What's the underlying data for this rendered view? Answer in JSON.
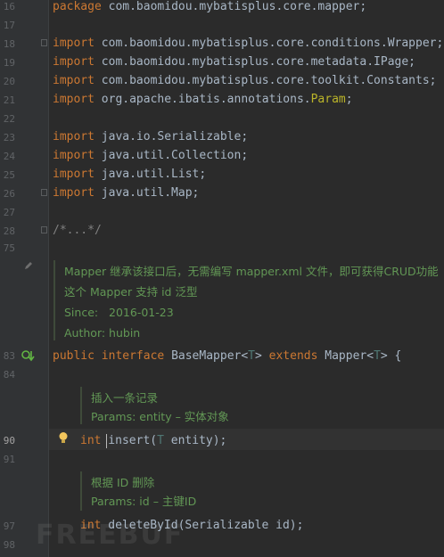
{
  "gutter": {
    "line_numbers": [
      "16",
      "17",
      "18",
      "19",
      "20",
      "21",
      "22",
      "23",
      "24",
      "25",
      "26",
      "27",
      "28",
      "75",
      "83",
      "84",
      "90",
      "91",
      "97",
      "98"
    ]
  },
  "code": {
    "l16": {
      "kw": "package",
      "rest": " com.baomidou.mybatisplus.core.mapper;"
    },
    "l18": {
      "kw": "import",
      "rest": " com.baomidou.mybatisplus.core.conditions.Wrapper;"
    },
    "l19": {
      "kw": "import",
      "rest": " com.baomidou.mybatisplus.core.metadata.IPage;"
    },
    "l20": {
      "kw": "import",
      "rest": " com.baomidou.mybatisplus.core.toolkit.Constants;"
    },
    "l21": {
      "kw": "import",
      "rest": " org.apache.ibatis.annotations.",
      "ann": "Param",
      "end": ";"
    },
    "l23": {
      "kw": "import",
      "rest": " java.io.Serializable;"
    },
    "l24": {
      "kw": "import",
      "rest": " java.util.Collection;"
    },
    "l25": {
      "kw": "import",
      "rest": " java.util.List;"
    },
    "l26": {
      "kw": "import",
      "rest": " java.util.Map;"
    },
    "l28": "/*...*/",
    "l83": {
      "kw1": "public",
      "kw2": "interface",
      "cls": "BaseMapper<",
      "tp": "T",
      "mid": "> ",
      "kw3": "extends",
      "cls2": " Mapper<",
      "tp2": "T",
      "end": "> {"
    },
    "l90": {
      "kw": "int",
      "name": " insert(",
      "tp": "T",
      "rest": " entity);"
    },
    "l97": {
      "kw": "int",
      "name": " deleteById(Serializable id);"
    }
  },
  "docs": {
    "class_doc": [
      "Mapper 继承该接口后，无需编写 mapper.xml 文件，即可获得CRUD功能",
      "这个 Mapper 支持 id 泛型",
      "Since:   2016-01-23",
      "Author: hubin"
    ],
    "insert_doc": [
      "插入一条记录",
      "Params: entity – 实体对象"
    ],
    "delete_doc": [
      "根据 ID 删除",
      "Params: id – 主键ID"
    ]
  },
  "watermark": "FREEBUF"
}
